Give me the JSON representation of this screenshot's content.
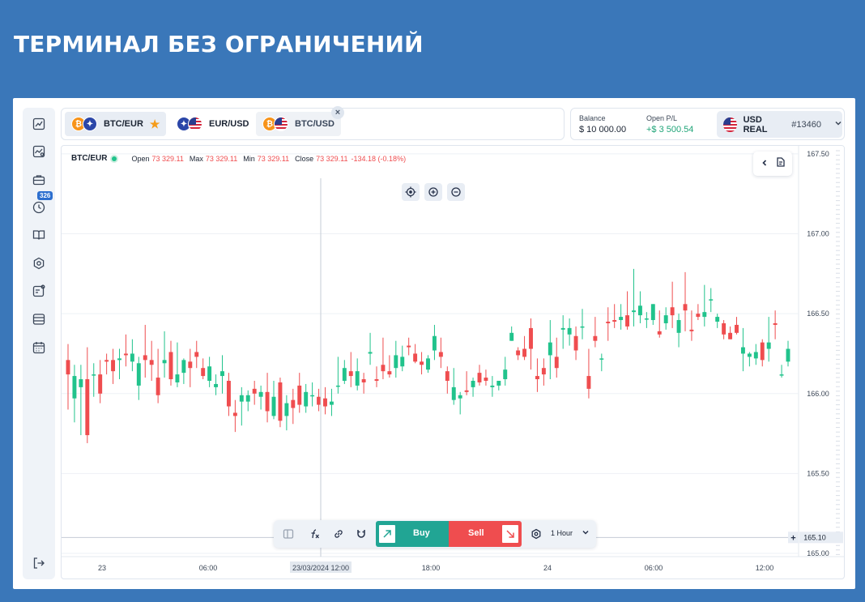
{
  "header": {
    "title": "ТЕРМИНАЛ БЕЗ ОГРАНИЧЕНИЙ"
  },
  "sidebar": {
    "items": [
      {
        "icon": "chart-icon"
      },
      {
        "icon": "analytics-icon"
      },
      {
        "icon": "portfolio-icon",
        "badge": "326"
      },
      {
        "icon": "history-icon"
      },
      {
        "icon": "book-icon"
      },
      {
        "icon": "settings-icon"
      },
      {
        "icon": "news-icon"
      },
      {
        "icon": "database-icon"
      },
      {
        "icon": "calendar-icon"
      }
    ],
    "logout_icon": "logout-icon"
  },
  "tabs": [
    {
      "label": "BTC/EUR",
      "favorite": true,
      "active": true
    },
    {
      "label": "EUR/USD"
    },
    {
      "label": "BTC/USD"
    }
  ],
  "account": {
    "balance_label": "Balance",
    "balance_value": "$ 10 000.00",
    "pl_label": "Open P/L",
    "pl_value": "+$ 3 500.54",
    "name": "USD REAL",
    "id": "#13460"
  },
  "chart_legend": {
    "symbol": "BTC/EUR",
    "open_label": "Open",
    "open": "73 329.11",
    "max_label": "Max",
    "max": "73 329.11",
    "min_label": "Min",
    "min": "73 329.11",
    "close_label": "Close",
    "close": "73 329.11",
    "change": "-134.18 (-0.18%)"
  },
  "toolbar": {
    "buy_label": "Buy",
    "sell_label": "Sell",
    "timeframe": "1 Hour"
  },
  "colors": {
    "up": "#21c38c",
    "down": "#ef4d4f",
    "accent": "#2d6fcf"
  },
  "chart_data": {
    "type": "candlestick",
    "y_ticks": [
      "167.50",
      "167.00",
      "166.50",
      "166.00",
      "165.50",
      "165.00"
    ],
    "ylim": [
      164.98,
      167.55
    ],
    "x_ticks": [
      "23",
      "06:00",
      "23/03/2024 12:00",
      "18:00",
      "24",
      "06:00",
      "12:00"
    ],
    "crosshair": {
      "price": "165.10",
      "time": "23/03/2024 12:00"
    },
    "candles": [
      [
        166.21,
        166.12,
        166.31,
        165.9
      ],
      [
        165.97,
        166.11,
        166.18,
        165.82
      ],
      [
        166.04,
        166.09,
        166.18,
        165.74
      ],
      [
        166.09,
        165.74,
        166.29,
        165.69
      ],
      [
        166.12,
        166.12,
        166.19,
        165.98
      ],
      [
        166.12,
        166.0,
        166.21,
        165.94
      ],
      [
        166.21,
        166.2,
        166.25,
        166.12
      ],
      [
        166.21,
        166.14,
        166.28,
        166.06
      ],
      [
        166.21,
        166.22,
        166.28,
        166.09
      ],
      [
        166.25,
        166.24,
        166.37,
        166.17
      ],
      [
        166.2,
        166.25,
        166.34,
        166.14
      ],
      [
        166.05,
        166.19,
        166.23,
        165.96
      ],
      [
        166.24,
        166.21,
        166.43,
        166.1
      ],
      [
        166.21,
        166.18,
        166.33,
        166.08
      ],
      [
        166.1,
        165.99,
        166.28,
        165.94
      ],
      [
        166.19,
        166.21,
        166.39,
        166.1
      ],
      [
        166.26,
        166.09,
        166.33,
        166.05
      ],
      [
        166.07,
        166.12,
        166.32,
        166.04
      ],
      [
        166.13,
        166.21,
        166.22,
        166.06
      ],
      [
        166.2,
        166.16,
        166.28,
        166.04
      ],
      [
        166.26,
        166.23,
        166.33,
        166.16
      ],
      [
        166.16,
        166.11,
        166.22,
        166.09
      ],
      [
        166.08,
        166.17,
        166.23,
        166.04
      ],
      [
        166.04,
        166.06,
        166.12,
        165.99
      ],
      [
        166.11,
        166.14,
        166.24,
        166.0
      ],
      [
        166.08,
        165.92,
        166.13,
        165.86
      ],
      [
        165.88,
        165.86,
        165.96,
        165.76
      ],
      [
        165.95,
        165.99,
        166.04,
        165.8
      ],
      [
        165.95,
        165.99,
        166.02,
        165.89
      ],
      [
        166.03,
        166.0,
        166.08,
        165.93
      ],
      [
        165.98,
        166.01,
        166.05,
        165.9
      ],
      [
        166.01,
        165.89,
        166.13,
        165.82
      ],
      [
        165.86,
        165.98,
        166.08,
        165.84
      ],
      [
        166.07,
        165.83,
        166.1,
        165.79
      ],
      [
        165.86,
        165.94,
        165.99,
        165.77
      ],
      [
        165.96,
        165.91,
        166.03,
        165.81
      ],
      [
        166.05,
        165.93,
        166.13,
        165.88
      ],
      [
        165.92,
        166.01,
        166.06,
        165.88
      ],
      [
        165.99,
        165.99,
        166.07,
        165.92
      ],
      [
        165.98,
        165.93,
        166.03,
        165.89
      ],
      [
        165.97,
        165.92,
        166.04,
        165.87
      ],
      [
        165.93,
        165.95,
        166.03,
        165.86
      ],
      [
        166.05,
        166.05,
        166.23,
        166.0
      ],
      [
        166.08,
        166.16,
        166.21,
        166.06
      ],
      [
        166.14,
        166.11,
        166.26,
        166.04
      ],
      [
        166.05,
        166.14,
        166.22,
        166.02
      ],
      [
        166.09,
        166.07,
        166.13,
        166.0
      ],
      [
        166.25,
        166.26,
        166.38,
        166.18
      ],
      [
        166.09,
        166.08,
        166.17,
        166.04
      ],
      [
        166.18,
        166.14,
        166.35,
        166.09
      ],
      [
        166.14,
        166.12,
        166.24,
        166.1
      ],
      [
        166.16,
        166.24,
        166.33,
        166.1
      ],
      [
        166.17,
        166.23,
        166.3,
        166.14
      ],
      [
        166.3,
        166.29,
        166.35,
        166.24
      ],
      [
        166.25,
        166.2,
        166.31,
        166.19
      ],
      [
        166.2,
        166.18,
        166.26,
        166.12
      ],
      [
        166.15,
        166.22,
        166.24,
        166.13
      ],
      [
        166.27,
        166.36,
        166.43,
        166.21
      ],
      [
        166.26,
        166.23,
        166.35,
        166.16
      ],
      [
        166.14,
        166.08,
        166.17,
        166.0
      ],
      [
        165.96,
        166.04,
        166.16,
        165.93
      ],
      [
        165.97,
        165.99,
        166.01,
        165.87
      ],
      [
        166.02,
        166.01,
        166.14,
        165.99
      ],
      [
        166.04,
        166.08,
        166.1,
        165.98
      ],
      [
        166.13,
        166.07,
        166.18,
        166.05
      ],
      [
        166.1,
        166.08,
        166.15,
        166.05
      ],
      [
        166.04,
        166.05,
        166.11,
        165.98
      ],
      [
        166.05,
        166.08,
        166.08,
        166.02
      ],
      [
        166.09,
        166.15,
        166.23,
        166.05
      ],
      [
        166.33,
        166.38,
        166.42,
        166.33
      ],
      [
        166.27,
        166.24,
        166.29,
        166.21
      ],
      [
        166.28,
        166.23,
        166.36,
        166.21
      ],
      [
        166.41,
        166.28,
        166.47,
        166.15
      ],
      [
        166.11,
        166.09,
        166.22,
        166.01
      ],
      [
        166.16,
        166.12,
        166.22,
        166.05
      ],
      [
        166.24,
        166.32,
        166.46,
        166.09
      ],
      [
        166.23,
        166.16,
        166.35,
        166.1
      ],
      [
        166.4,
        166.41,
        166.49,
        166.28
      ],
      [
        166.37,
        166.41,
        166.47,
        166.3
      ],
      [
        166.36,
        166.27,
        166.42,
        166.21
      ],
      [
        166.42,
        166.42,
        166.53,
        166.34
      ],
      [
        166.11,
        166.03,
        166.28,
        165.97
      ],
      [
        166.36,
        166.33,
        166.48,
        166.29
      ],
      [
        166.22,
        166.22,
        166.25,
        166.14
      ],
      [
        166.45,
        166.44,
        166.54,
        166.33
      ],
      [
        166.46,
        166.45,
        166.56,
        166.41
      ],
      [
        166.46,
        166.48,
        166.56,
        166.4
      ],
      [
        166.49,
        166.42,
        166.64,
        166.4
      ],
      [
        166.51,
        166.52,
        166.78,
        166.42
      ],
      [
        166.49,
        166.55,
        166.64,
        166.44
      ],
      [
        166.47,
        166.47,
        166.51,
        166.41
      ],
      [
        166.46,
        166.56,
        166.56,
        166.43
      ],
      [
        166.39,
        166.37,
        166.52,
        166.35
      ],
      [
        166.44,
        166.49,
        166.54,
        166.4
      ],
      [
        166.54,
        166.49,
        166.7,
        166.41
      ],
      [
        166.38,
        166.46,
        166.5,
        166.29
      ],
      [
        166.56,
        166.52,
        166.76,
        166.39
      ],
      [
        166.4,
        166.39,
        166.52,
        166.33
      ],
      [
        166.5,
        166.48,
        166.56,
        166.46
      ],
      [
        166.48,
        166.51,
        166.68,
        166.42
      ],
      [
        166.59,
        166.59,
        166.66,
        166.51
      ],
      [
        166.45,
        166.48,
        166.5,
        166.41
      ],
      [
        166.44,
        166.37,
        166.46,
        166.34
      ],
      [
        166.38,
        166.34,
        166.42,
        166.34
      ],
      [
        166.43,
        166.38,
        166.48,
        166.37
      ],
      [
        166.25,
        166.29,
        166.41,
        166.14
      ],
      [
        166.23,
        166.25,
        166.26,
        166.17
      ],
      [
        166.22,
        166.26,
        166.31,
        166.18
      ],
      [
        166.32,
        166.21,
        166.34,
        166.17
      ],
      [
        166.28,
        166.32,
        166.48,
        166.2
      ],
      [
        166.44,
        166.43,
        166.52,
        166.34
      ],
      [
        166.12,
        166.12,
        166.18,
        166.1
      ],
      [
        166.2,
        166.28,
        166.33,
        166.17
      ]
    ]
  }
}
